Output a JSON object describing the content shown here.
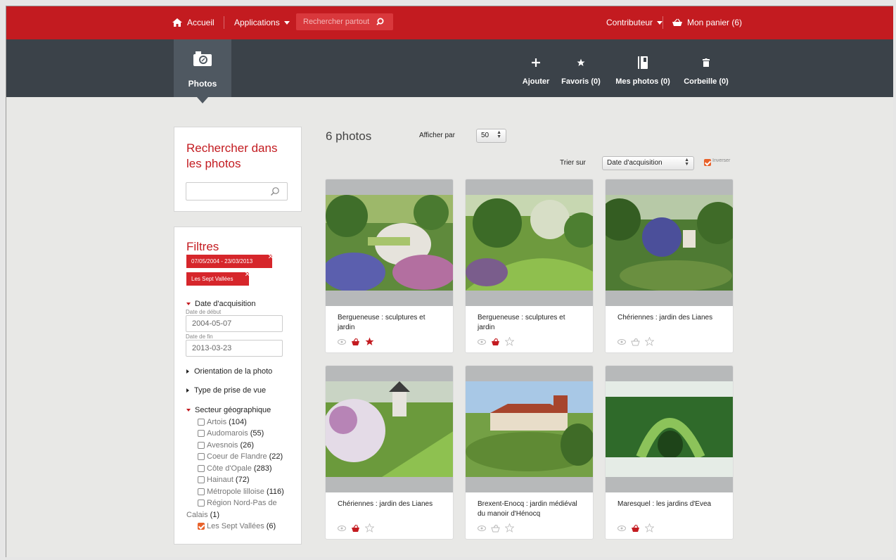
{
  "topbar": {
    "home_label": "Accueil",
    "apps_label": "Applications",
    "search_placeholder": "Rechercher partout",
    "contributor_label": "Contributeur",
    "cart_label": "Mon panier (6)",
    "colors": {
      "brand_red": "#c31b20",
      "dark": "#3b4249"
    }
  },
  "module": {
    "tab_label": "Photos",
    "actions": [
      {
        "icon": "plus-icon",
        "label": "Ajouter"
      },
      {
        "icon": "star-icon",
        "label": "Favoris (0)"
      },
      {
        "icon": "book-icon",
        "label": "Mes photos (0)"
      },
      {
        "icon": "trash-icon",
        "label": "Corbeille (0)"
      }
    ]
  },
  "search_panel": {
    "title": "Rechercher dans les photos",
    "input_value": ""
  },
  "filters": {
    "title": "Filtres",
    "active_tags": [
      "07/05/2004 - 23/03/2013",
      "Les Sept Vallées"
    ],
    "date_section": {
      "title": "Date d'acquisition",
      "start_label": "Date de début",
      "start_value": "2004-05-07",
      "end_label": "Date de fin",
      "end_value": "2013-03-23"
    },
    "orientation_title": "Orientation de la photo",
    "shot_type_title": "Type de prise de vue",
    "geo_section": {
      "title": "Secteur géographique",
      "items": [
        {
          "label": "Artois",
          "count": "(104)",
          "checked": false
        },
        {
          "label": "Audomarois",
          "count": "(55)",
          "checked": false
        },
        {
          "label": "Avesnois",
          "count": "(26)",
          "checked": false
        },
        {
          "label": "Coeur de Flandre",
          "count": "(22)",
          "checked": false
        },
        {
          "label": "Côte d'Opale",
          "count": "(283)",
          "checked": false
        },
        {
          "label": "Hainaut",
          "count": "(72)",
          "checked": false
        },
        {
          "label": "Métropole lilloise",
          "count": "(116)",
          "checked": false
        },
        {
          "label": "Région Nord-Pas de",
          "label2": "Calais",
          "count": "(1)",
          "checked": false
        },
        {
          "label": "Les Sept Vallées",
          "count": "(6)",
          "checked": true
        }
      ]
    }
  },
  "results": {
    "count_label": "6 photos",
    "per_page_label": "Afficher par",
    "per_page_value": "50",
    "sort_label": "Trier sur",
    "sort_value": "Date d'acquisition",
    "invert_label": "Inverser",
    "invert_checked": true,
    "photos": [
      {
        "title": "Bergueneuse : sculptures et jardin",
        "in_cart": true,
        "favorite": true
      },
      {
        "title": "Bergueneuse : sculptures et jardin",
        "in_cart": true,
        "favorite": false
      },
      {
        "title": "Chériennes : jardin des Lianes",
        "in_cart": false,
        "favorite": false
      },
      {
        "title": "Chériennes : jardin des Lianes",
        "in_cart": true,
        "favorite": false
      },
      {
        "title": "Brexent-Enocq : jardin médiéval du manoir d'Hénocq",
        "in_cart": false,
        "favorite": false
      },
      {
        "title": "Maresquel : les jardins d'Evea",
        "in_cart": true,
        "favorite": false
      }
    ]
  }
}
